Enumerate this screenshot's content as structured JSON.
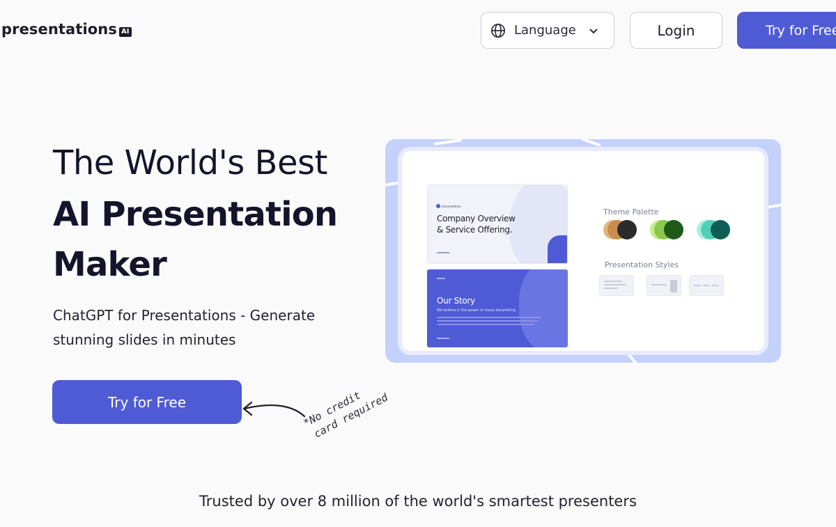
{
  "header": {
    "logo_text": "presentations",
    "logo_badge": "AI",
    "language_label": "Language",
    "login_label": "Login",
    "try_label": "Try for Free"
  },
  "hero": {
    "title_line1": "The World's Best",
    "title_line2": "AI Presentation",
    "title_line3": "Maker",
    "subtitle": "ChatGPT for Presentations - Generate stunning slides in minutes",
    "cta_label": "Try for Free",
    "note_line1": "*No credit",
    "note_line2": "card required"
  },
  "preview": {
    "slide1_title_line1": "Company Overview",
    "slide1_title_line2": "& Service Offering.",
    "slide2_title": "Our Story",
    "slide2_subtitle": "We believe in the power of visual storytelling.",
    "palette_label": "Theme Palette",
    "styles_label": "Presentation Styles",
    "palette_colors": [
      "#d6a96a",
      "#2b2b2b",
      "#9bd35b",
      "#1f5a1a",
      "#6fe0c6",
      "#0f5e55"
    ]
  },
  "footer": {
    "trusted_text": "Trusted by over 8 million of the world's smartest presenters"
  },
  "colors": {
    "accent": "#4f5bd5",
    "mockup_bg": "#c4d1fb"
  }
}
